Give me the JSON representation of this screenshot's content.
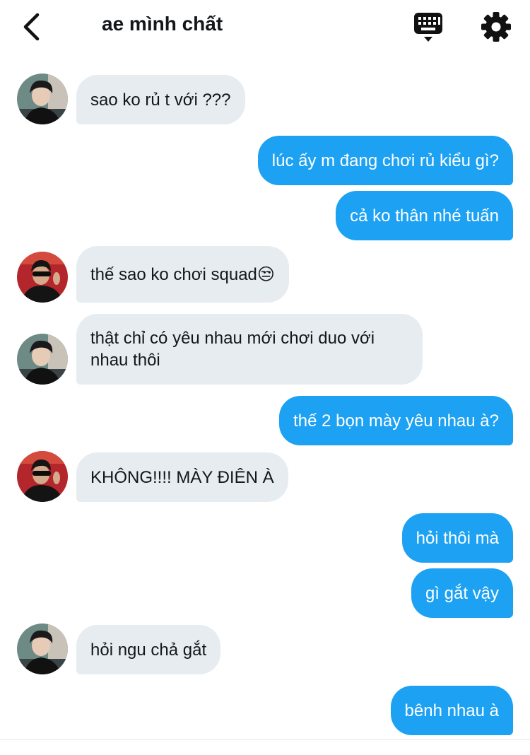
{
  "header": {
    "title": "ae mình chất",
    "back_icon": "chevron-left-icon",
    "keyboard_icon": "keyboard-icon",
    "settings_icon": "gear-icon"
  },
  "colors": {
    "outgoing_bubble": "#1da1f2",
    "incoming_bubble": "#e6ecf0",
    "text": "#14171a"
  },
  "messages": [
    {
      "direction": "in",
      "sender_avatar": "avatar-a",
      "text": "sao ko rủ t với ???"
    },
    {
      "direction": "out",
      "text": "lúc ấy m đang chơi rủ kiểu gì?"
    },
    {
      "direction": "out",
      "text": "cả ko thân nhé tuấn"
    },
    {
      "direction": "in",
      "sender_avatar": "avatar-b",
      "text": "thế sao ko chơi squad😒"
    },
    {
      "direction": "in",
      "sender_avatar": "avatar-a",
      "text": "thật chỉ có yêu nhau mới chơi duo với nhau thôi"
    },
    {
      "direction": "out",
      "text": "thế 2 bọn mày yêu nhau à?"
    },
    {
      "direction": "in",
      "sender_avatar": "avatar-b",
      "text": "KHÔNG!!!! MÀY ĐIÊN À"
    },
    {
      "direction": "out",
      "text": "hỏi thôi mà"
    },
    {
      "direction": "out",
      "text": "gì gắt vậy"
    },
    {
      "direction": "in",
      "sender_avatar": "avatar-a",
      "text": "hỏi ngu chả gắt"
    },
    {
      "direction": "out",
      "text": "bênh nhau à"
    }
  ]
}
